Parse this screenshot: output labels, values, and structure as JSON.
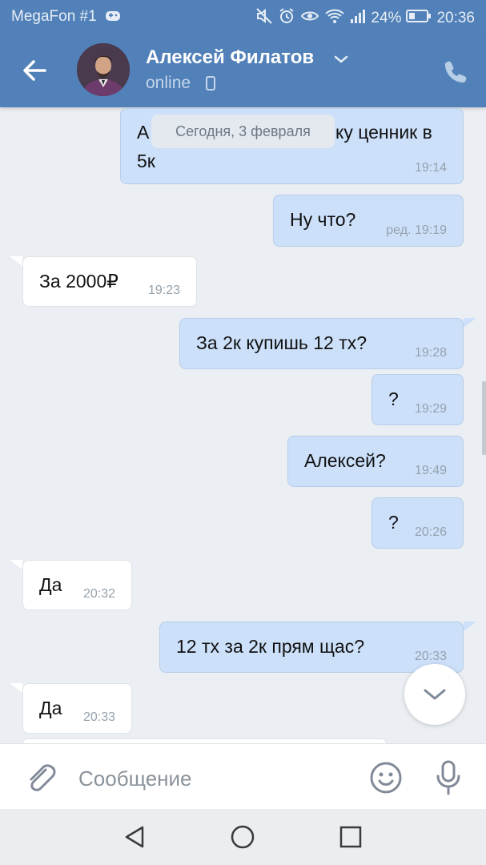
{
  "status_bar": {
    "carrier": "MegaFon #1",
    "battery": "24%",
    "time": "20:36",
    "icons": [
      "carrier-game-icon",
      "mute-icon",
      "alarm-icon",
      "eye-icon",
      "wifi-icon",
      "signal-icon",
      "battery-icon"
    ]
  },
  "header": {
    "name": "Алексей Филатов",
    "status": "online",
    "icons": [
      "back-arrow-icon",
      "chevron-down-icon",
      "phone-icon",
      "mobile-device-icon"
    ]
  },
  "date_separator": "Сегодня, 3 февраля",
  "messages": [
    {
      "dir": "out",
      "line1_start": "А",
      "line1_end": "ку ценник в",
      "line2": "5к",
      "time": "19:14"
    },
    {
      "dir": "out",
      "text": "Ну что?",
      "time": "ред. 19:19"
    },
    {
      "dir": "in",
      "text": "За 2000₽",
      "time": "19:23"
    },
    {
      "dir": "out",
      "text": "За 2к купишь 12 тх?",
      "time": "19:28"
    },
    {
      "dir": "out",
      "text": "?",
      "time": "19:29"
    },
    {
      "dir": "out",
      "text": "Алексей?",
      "time": "19:49"
    },
    {
      "dir": "out",
      "text": "?",
      "time": "20:26"
    },
    {
      "dir": "in",
      "text": "Да",
      "time": "20:32"
    },
    {
      "dir": "out",
      "text": "12 тх за 2к прям щас?",
      "time": "20:33"
    },
    {
      "dir": "in",
      "text": "Да",
      "time": "20:33"
    }
  ],
  "composer": {
    "placeholder": "Сообщение"
  },
  "colors": {
    "accent": "#5181b8",
    "outgoing_bubble": "#cce0fa",
    "incoming_bubble": "#ffffff",
    "background": "#ebeef2"
  }
}
